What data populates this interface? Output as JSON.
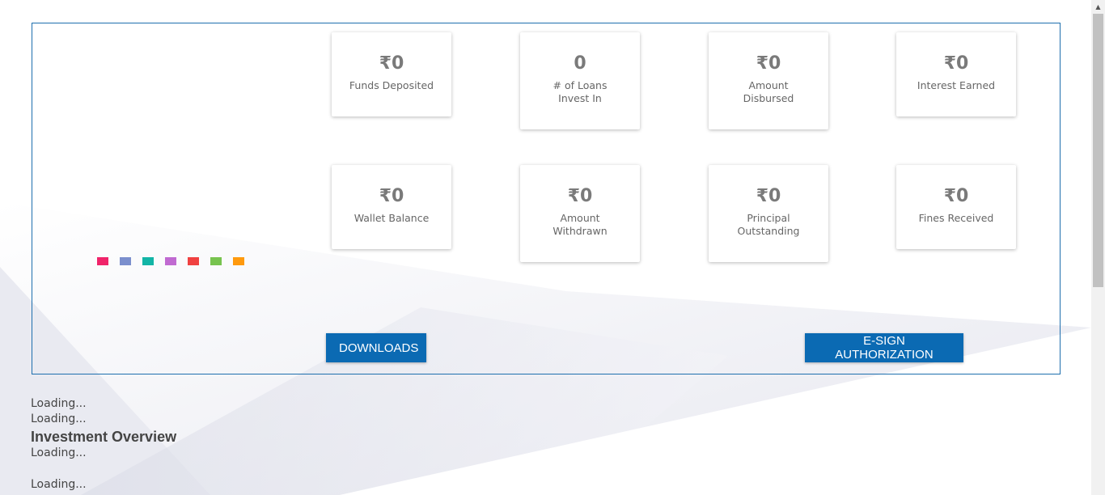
{
  "legend_colors": [
    "#f0246a",
    "#7b8fcd",
    "#12b5a6",
    "#c06ad1",
    "#f04141",
    "#77c34f",
    "#ff9a0e"
  ],
  "stats_row1": [
    {
      "value": "₹0",
      "label": "Funds Deposited"
    },
    {
      "value": "0",
      "label": "# of Loans Invest In"
    },
    {
      "value": "₹0",
      "label": "Amount Disbursed"
    },
    {
      "value": "₹0",
      "label": "Interest Earned"
    }
  ],
  "stats_row2": [
    {
      "value": "₹0",
      "label": "Wallet Balance"
    },
    {
      "value": "₹0",
      "label": "Amount Withdrawn"
    },
    {
      "value": "₹0",
      "label": "Principal Outstanding"
    },
    {
      "value": "₹0",
      "label": "Fines Received"
    }
  ],
  "buttons": {
    "downloads": "DOWNLOADS",
    "esign": "E-SIGN AUTHORIZATION"
  },
  "below": {
    "loading_1": "Loading...",
    "loading_2": "Loading...",
    "section_title": "Investment Overview",
    "loading_3": "Loading...",
    "loading_4": "Loading..."
  },
  "colors": {
    "accent": "#0b6ab3",
    "panel_border": "#1e6fae"
  }
}
